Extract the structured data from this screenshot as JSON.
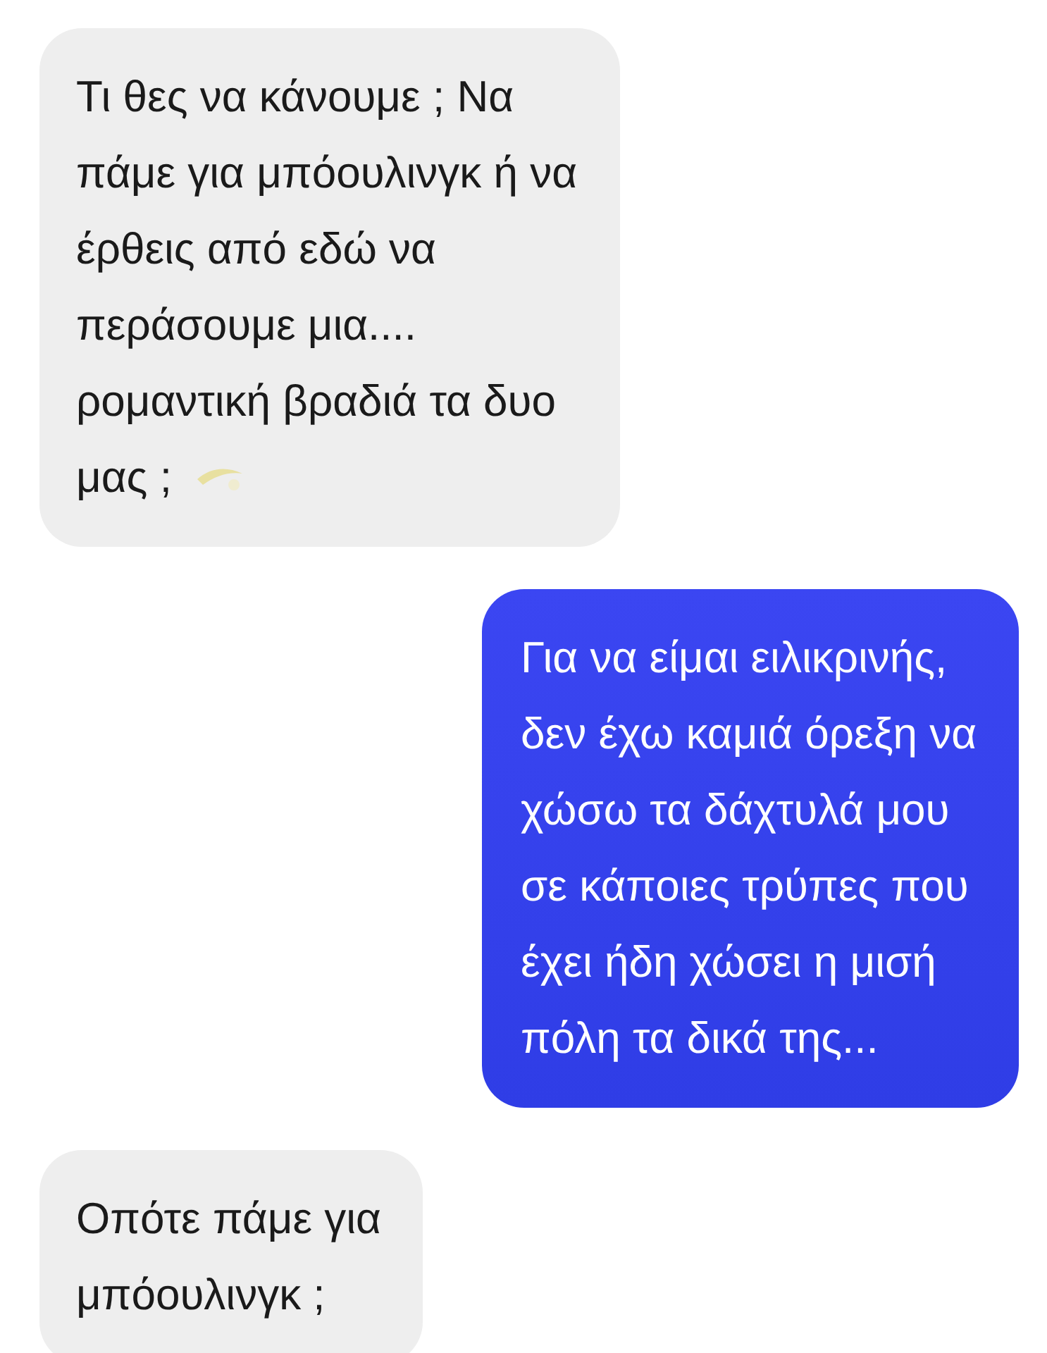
{
  "messages": [
    {
      "kind": "received",
      "lines": [
        "Τι θες να κάνουμε ; Να",
        "πάμε για μπόουλινγκ ή να",
        "έρθεις από εδώ να",
        "περάσουμε μια....",
        "ρομαντική βραδιά τα δυο",
        "μας ;"
      ],
      "trailing_emoji": true
    },
    {
      "kind": "sent",
      "lines": [
        "Για να είμαι ειλικρινής,",
        "δεν έχω καμιά όρεξη να",
        "χώσω τα δάχτυλά μου",
        "σε κάποιες τρύπες που",
        "έχει ήδη χώσει η μισή",
        "πόλη τα δικά της..."
      ],
      "trailing_emoji": false
    },
    {
      "kind": "received",
      "lines": [
        "Οπότε πάμε για",
        "μπόουλινγκ ;"
      ],
      "trailing_emoji": false
    }
  ]
}
